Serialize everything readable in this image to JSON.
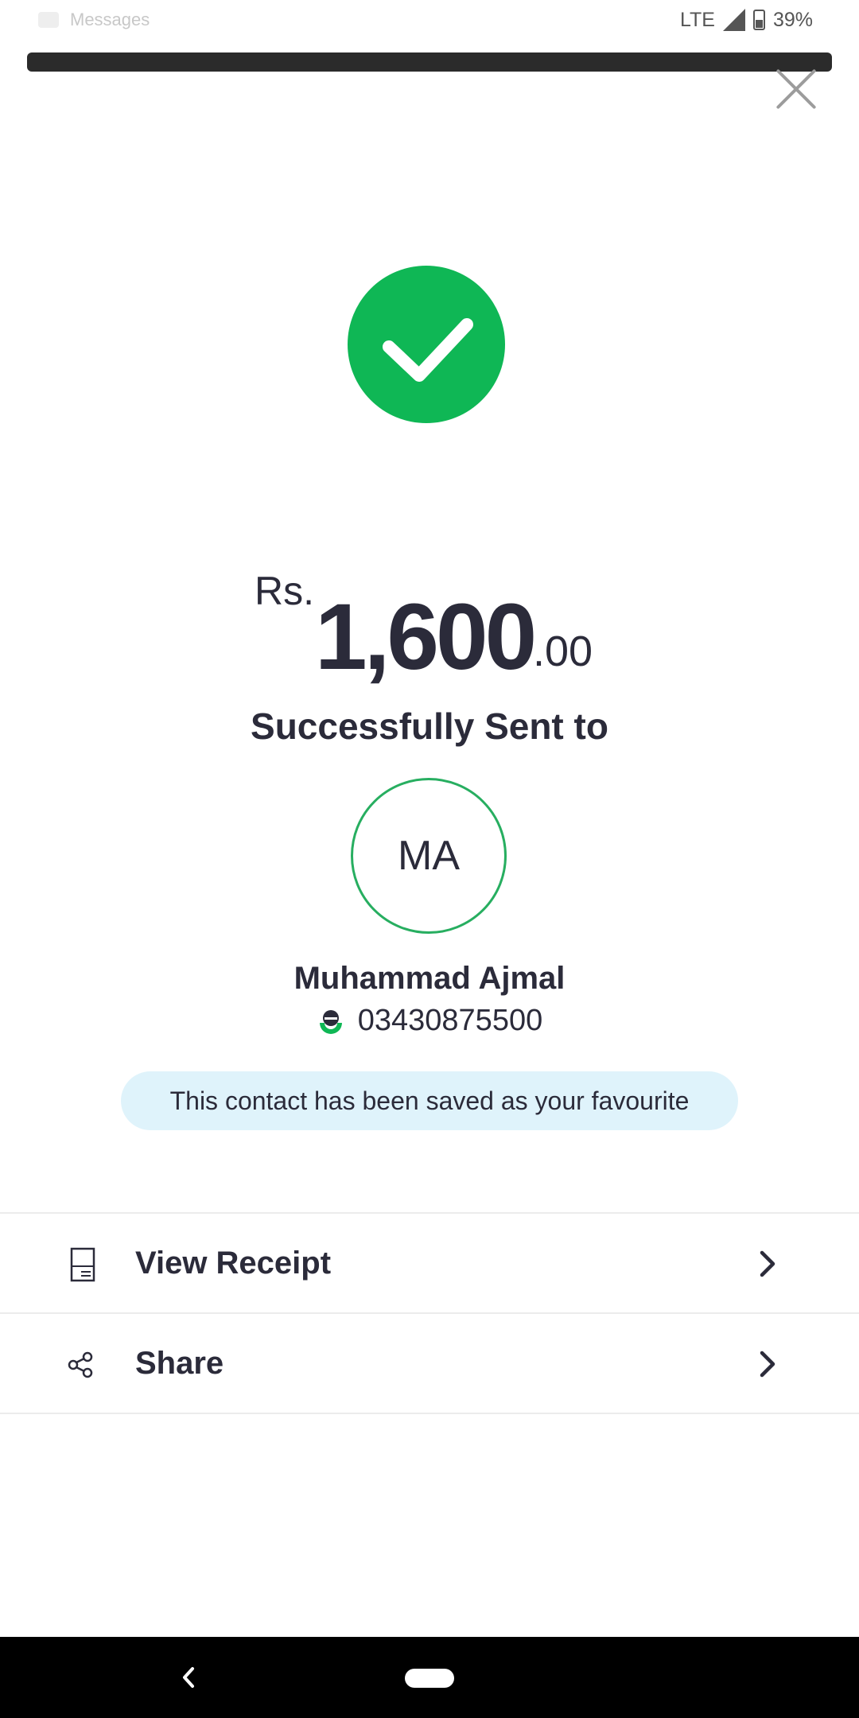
{
  "status_bar": {
    "notification_app": "Messages",
    "network": "LTE",
    "battery": "39%"
  },
  "transaction": {
    "currency": "Rs.",
    "amount_integer": "1,600",
    "amount_decimal": ".00",
    "status_text": "Successfully Sent to"
  },
  "recipient": {
    "initials": "MA",
    "name": "Muhammad Ajmal",
    "phone": "03430875500"
  },
  "favourite_banner": "This contact has been saved as your favourite",
  "actions": [
    {
      "label": "View Receipt",
      "icon": "receipt-icon"
    },
    {
      "label": "Share",
      "icon": "share-icon"
    }
  ],
  "colors": {
    "success": "#0fb755",
    "avatar_ring": "#27ae60",
    "banner_bg": "#dff3fb",
    "text": "#2b2b3a"
  }
}
